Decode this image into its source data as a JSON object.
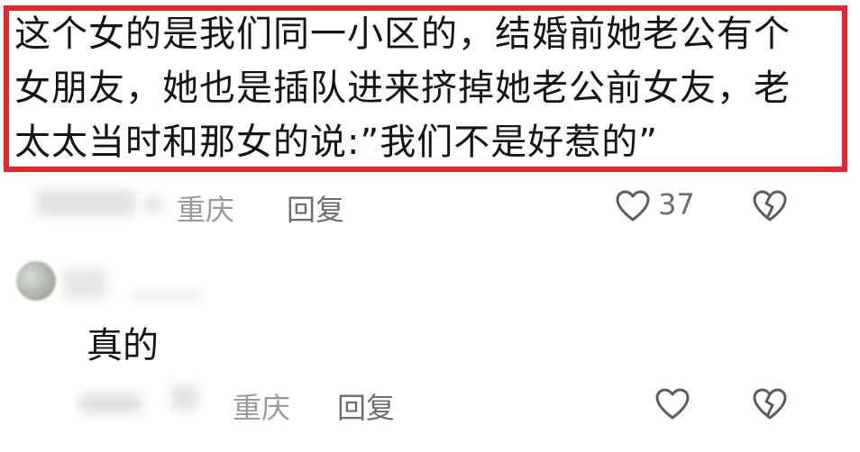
{
  "comment1": {
    "text": "这个女的是我们同一小区的，结婚前她老公有个\n女朋友，她也是插队进来挤掉她老公前女友，老\n太太当时和那女的说:”我们不是好惹的”",
    "location": "重庆",
    "reply_label": "回复",
    "like_count": "37"
  },
  "comment2": {
    "text": "真的",
    "location": "重庆",
    "reply_label": "回复"
  },
  "colors": {
    "highlight_border": "#e8262d",
    "meta_text": "#8a8a8a"
  },
  "icons": {
    "like": "heart-outline-icon",
    "dislike": "broken-heart-icon"
  }
}
